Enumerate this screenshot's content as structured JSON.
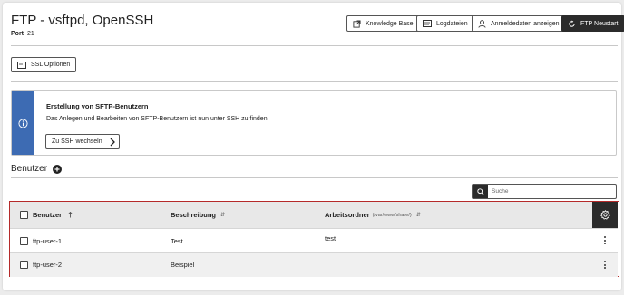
{
  "header": {
    "title": "FTP - vsftpd, OpenSSH",
    "port_label": "Port",
    "port_value": "21"
  },
  "toolbar": {
    "knowledge_base": "Knowledge Base",
    "logdateien": "Logdateien",
    "anmeldedaten": "Anmeldedaten anzeigen",
    "ftp_neustart": "FTP Neustart"
  },
  "ssl_options": "SSL Optionen",
  "info": {
    "title": "Erstellung von SFTP-Benutzern",
    "text": "Das Anlegen und Bearbeiten von SFTP-Benutzern ist nun unter SSH zu finden.",
    "button": "Zu SSH wechseln"
  },
  "users_section": {
    "title": "Benutzer"
  },
  "search": {
    "placeholder": "Suche"
  },
  "table": {
    "columns": {
      "user": "Benutzer",
      "description": "Beschreibung",
      "workdir": "Arbeitsordner",
      "workdir_hint": "(/var/www/share/)"
    },
    "rows": [
      {
        "user": "ftp-user-1",
        "description": "Test",
        "workdir": "test"
      },
      {
        "user": "ftp-user-2",
        "description": "Beispiel",
        "workdir": ""
      }
    ]
  },
  "colors": {
    "accent_blue": "#3d6bb3",
    "dark_button": "#2b2b2b",
    "highlight_border": "#b52a2a"
  }
}
